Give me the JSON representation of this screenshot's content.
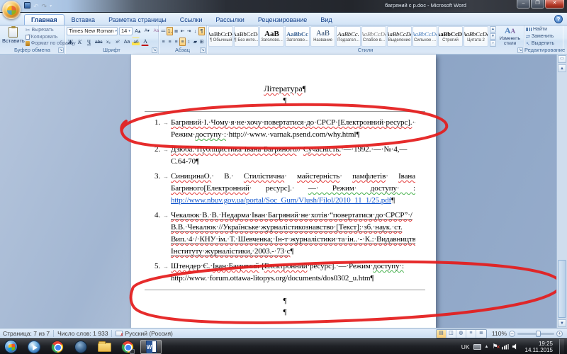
{
  "window": {
    "title": "багряний с p.doc - Microsoft Word",
    "controls": {
      "minimize": "–",
      "restore": "❐",
      "close": "✕"
    }
  },
  "qat": {
    "undo": "↶",
    "redo": "↷",
    "more": "▾"
  },
  "ribbon": {
    "tabs": [
      {
        "label": "Главная",
        "active": true
      },
      {
        "label": "Вставка"
      },
      {
        "label": "Разметка страницы"
      },
      {
        "label": "Ссылки"
      },
      {
        "label": "Рассылки"
      },
      {
        "label": "Рецензирование"
      },
      {
        "label": "Вид"
      }
    ],
    "help": "?",
    "clipboard": {
      "label": "Буфер обмена",
      "paste": "Вставить",
      "items": [
        "Вырезать",
        "Копировать",
        "Формат по образцу"
      ]
    },
    "font": {
      "label": "Шрифт",
      "family": "Times New Roman",
      "size": "14",
      "grow": "А▴",
      "shrink": "А▾",
      "clear": "Аа",
      "bold": "Ж",
      "italic": "К",
      "underline": "Ч",
      "strike": "abc",
      "subscript": "x₂",
      "superscript": "x²",
      "case": "Aa",
      "highlight": "аб",
      "color": "А"
    },
    "paragraph": {
      "label": "Абзац",
      "icons": {
        "bullets": "≔",
        "numbering": "⒈",
        "multilevel": "≣",
        "outdent": "⇤",
        "indent": "⇥",
        "sort": "↓",
        "marks": "¶",
        "left": "≡",
        "center": "≡",
        "right": "≡",
        "justify": "≡",
        "spacing": "↕",
        "shading": "▰",
        "borders": "⊞"
      }
    },
    "styles": {
      "label": "Стили",
      "change": "Изменить стили",
      "gallery": [
        {
          "sample": "AaBbCcDc",
          "name": "¶ Обычный"
        },
        {
          "sample": "AaBbCcDc",
          "name": "¶ Без инте..."
        },
        {
          "sample": "AaB",
          "name": "Заголово..."
        },
        {
          "sample": "AaBbCc",
          "name": "Заголово..."
        },
        {
          "sample": "АаВ",
          "name": "Название"
        },
        {
          "sample": "AaBbCc.",
          "name": "Подзагол..."
        },
        {
          "sample": "AaBbCcDc",
          "name": "Слабое в..."
        },
        {
          "sample": "AaBbCcDc",
          "name": "Выделение"
        },
        {
          "sample": "AaBbCcDc",
          "name": "Сильное ..."
        },
        {
          "sample": "AaBbCcDc",
          "name": "Строгий"
        },
        {
          "sample": "AaBbCcDc",
          "name": "Цитата 2"
        }
      ]
    },
    "editing": {
      "label": "Редактирование",
      "items": [
        "Найти",
        "Заменить",
        "Выделить"
      ]
    }
  },
  "document": {
    "title": "Література",
    "pilcrow": "¶",
    "tab_mark": "→",
    "items": [
      {
        "num": "1.",
        "lines": [
          {
            "seg": [
              {
                "c": "sp",
                "t": "Багряний·І.·Чому·я·не·хочу·повертатися·до·СРСР·[Електронний·ресурс]."
              },
              {
                "c": "",
                "t": "·—"
              }
            ]
          },
          {
            "seg": [
              {
                "c": "",
                "t": "Режим·"
              },
              {
                "c": "gr",
                "t": "доступу·:"
              },
              {
                "c": "",
                "t": "·http://·www.·varnak.psend.com/why.html¶"
              }
            ]
          }
        ]
      },
      {
        "num": "2.",
        "lines": [
          {
            "seg": [
              {
                "c": "sp",
                "t": "Дзюба.·Публіцистика·Івана·Багряного"
              },
              {
                "c": "",
                "t": "//·"
              },
              {
                "c": "sp",
                "t": "Сучасність."
              },
              {
                "c": "",
                "t": "·—·1992.·—·№·4,—"
              }
            ]
          },
          {
            "seg": [
              {
                "c": "",
                "t": "С.64-70¶"
              }
            ]
          }
        ]
      },
      {
        "num": "3.",
        "lines": [
          {
            "just": true,
            "seg": [
              {
                "c": "sp",
                "t": "СиницинаО."
              },
              {
                "c": "",
                "t": "· В.· "
              },
              {
                "c": "sp",
                "t": "Стилістична"
              },
              {
                "c": "",
                "t": "· "
              },
              {
                "c": "sp",
                "t": "майстерність"
              },
              {
                "c": "",
                "t": "· "
              },
              {
                "c": "sp",
                "t": "памфлетів"
              },
              {
                "c": "",
                "t": "· "
              },
              {
                "c": "sp",
                "t": "Івана"
              }
            ]
          },
          {
            "just": true,
            "seg": [
              {
                "c": "sp",
                "t": "Багряного[Електронний"
              },
              {
                "c": "",
                "t": "· ресурс].· "
              },
              {
                "c": "gr",
                "t": "—· Режим· доступу· :"
              }
            ]
          },
          {
            "seg": [
              {
                "c": "lk",
                "t": "http://www.nbuv.gov.ua/portal/Soc_Gum/Vlush/Filol/2010_11_1/25.pdf"
              },
              {
                "c": "",
                "t": "¶"
              }
            ]
          }
        ]
      },
      {
        "num": "4.",
        "lines": [
          {
            "seg": [
              {
                "c": "u sp",
                "t": "Чекалюк·В.·В.·Недарма·Іван·Багряний·не·хотів·“повертатися·до·СРСР”·/"
              }
            ]
          },
          {
            "seg": [
              {
                "c": "u sp",
                "t": "В.В.·Чекалюк·//Українське·журналістикознавство·[Текст]:·зб.·наук.·ст."
              }
            ]
          },
          {
            "seg": [
              {
                "c": "u sp",
                "t": "Вип.·4·/·КНУ·ім.·Т.·Шевченка;·Ін-т·журналістики·та·ін..·-·К.:·Видавництво"
              }
            ]
          },
          {
            "seg": [
              {
                "c": "u sp",
                "t": "Інституту·журналістики,·2003.-·73·с"
              },
              {
                "c": "",
                "t": "¶"
              }
            ]
          }
        ]
      },
      {
        "num": "5.",
        "lines": [
          {
            "seg": [
              {
                "c": "sp",
                "t": "Штендер"
              },
              {
                "c": "",
                "t": "·Є.·"
              },
              {
                "c": "sp",
                "t": "Іван·Багряний"
              },
              {
                "c": "",
                "t": "·["
              },
              {
                "c": "sp",
                "t": "Електронний"
              },
              {
                "c": "",
                "t": "·ресурс].·—·Режим·"
              },
              {
                "c": "gr",
                "t": "доступу·:"
              }
            ]
          },
          {
            "seg": [
              {
                "c": "",
                "t": "http://www.·forum.ottawa-litopys.org/documents/dos0302_u.htm¶"
              }
            ]
          }
        ]
      }
    ],
    "trailing_pilcrows": [
      "¶",
      "¶"
    ]
  },
  "status": {
    "page": "Страница: 7 из 7",
    "words": "Число слов: 1 933",
    "language": "Русский (Россия)",
    "zoom": "110%",
    "zoom_out": "–",
    "zoom_in": "+"
  },
  "taskbar": {
    "lang": "UK",
    "time": "19:25",
    "date": "14.11.2015"
  },
  "colors": {
    "annotation_red": "#e41c1c",
    "hyperlink_blue": "#1155cc",
    "spell_red": "#e43b3b",
    "grammar_green": "#3faf46"
  }
}
